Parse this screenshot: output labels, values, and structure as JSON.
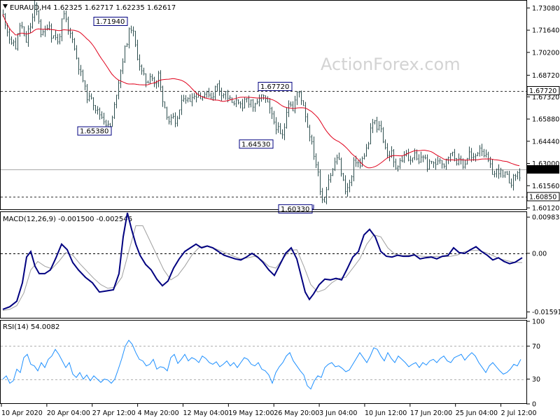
{
  "chart_data": [
    {
      "type": "candlestick",
      "header": "EURAUD,H4  1.62325 1.62717 1.62235 1.62617",
      "watermark": "ActionForex.com",
      "ylim": [
        1.6003,
        1.7355
      ],
      "y_ticks": [
        "1.73080",
        "1.71640",
        "1.70200",
        "1.68720",
        "1.67320",
        "1.65880",
        "1.64440",
        "1.63000",
        "1.61560",
        "1.60120"
      ],
      "horizontal_lines": [
        {
          "value": 1.6772,
          "label": "1.67720",
          "style": "dashed"
        },
        {
          "value": 1.6085,
          "label": "1.60850",
          "style": "dashed"
        },
        {
          "value": 1.62617,
          "label": "1.62617",
          "style": "solid-current-price"
        }
      ],
      "annotations": [
        {
          "label": "1.71940",
          "value": 1.7194
        },
        {
          "label": "1.65380",
          "value": 1.6538
        },
        {
          "label": "1.67720",
          "value": 1.6772
        },
        {
          "label": "1.64530",
          "value": 1.6453
        },
        {
          "label": "1.60330",
          "value": 1.6033
        }
      ],
      "moving_average": {
        "color": "#e0001b"
      },
      "price_path": {
        "x": [
          0,
          4,
          8,
          12,
          16,
          19,
          22,
          26,
          29,
          33,
          36,
          40,
          45,
          50,
          55,
          60,
          65,
          70,
          74,
          78,
          82,
          86,
          90,
          94,
          98,
          102,
          106,
          110,
          114,
          118,
          122,
          126,
          130,
          134,
          138,
          142,
          146,
          150,
          154,
          158,
          162,
          166,
          170,
          174,
          178,
          182,
          186,
          190,
          194,
          198,
          202,
          206,
          210,
          214,
          218,
          222,
          226,
          230,
          234,
          238,
          242,
          246,
          250,
          254,
          258,
          262,
          266,
          270,
          274,
          278,
          282,
          286,
          290,
          294,
          298,
          302,
          306,
          310,
          314,
          318,
          322,
          326,
          330,
          334,
          338,
          342,
          346,
          350,
          354,
          358,
          362,
          366,
          370,
          374,
          378,
          382,
          386,
          390,
          394,
          398,
          402,
          406,
          410,
          414,
          418,
          422,
          426,
          430,
          434,
          438,
          442,
          446,
          450,
          454,
          458,
          462,
          466,
          470,
          474,
          478,
          482,
          486,
          490,
          494,
          498,
          502,
          506,
          510,
          514,
          518,
          522,
          526,
          530,
          534,
          538,
          542,
          546,
          550,
          554,
          558,
          562,
          566,
          570,
          574,
          578,
          582,
          586,
          590,
          594,
          598,
          602,
          606,
          610,
          614,
          618,
          622,
          626,
          630,
          634,
          638,
          642,
          646,
          650,
          654,
          658,
          662,
          666,
          670,
          674,
          678,
          682,
          686,
          690,
          694,
          698,
          702,
          706,
          710,
          714,
          718,
          722,
          726,
          730,
          734,
          738
        ],
        "y": [
          1.726,
          1.72,
          1.713,
          1.706,
          1.71,
          1.703,
          1.718,
          1.721,
          1.712,
          1.709,
          1.716,
          1.72,
          1.731,
          1.726,
          1.712,
          1.716,
          1.722,
          1.711,
          1.714,
          1.708,
          1.716,
          1.727,
          1.722,
          1.713,
          1.715,
          1.704,
          1.697,
          1.689,
          1.684,
          1.676,
          1.671,
          1.674,
          1.668,
          1.664,
          1.662,
          1.66,
          1.657,
          1.654,
          1.6538,
          1.664,
          1.676,
          1.686,
          1.695,
          1.704,
          1.711,
          1.7194,
          1.714,
          1.703,
          1.696,
          1.689,
          1.685,
          1.682,
          1.688,
          1.685,
          1.679,
          1.688,
          1.676,
          1.668,
          1.662,
          1.656,
          1.66,
          1.654,
          1.662,
          1.667,
          1.674,
          1.672,
          1.67,
          1.675,
          1.673,
          1.676,
          1.672,
          1.677,
          1.674,
          1.676,
          1.672,
          1.678,
          1.681,
          1.677,
          1.675,
          1.676,
          1.672,
          1.67,
          1.667,
          1.674,
          1.668,
          1.664,
          1.673,
          1.67,
          1.671,
          1.666,
          1.667,
          1.673,
          1.673,
          1.672,
          1.668,
          1.663,
          1.658,
          1.654,
          1.651,
          1.6453,
          1.654,
          1.669,
          1.671,
          1.664,
          1.673,
          1.6772,
          1.672,
          1.667,
          1.656,
          1.649,
          1.64,
          1.632,
          1.623,
          1.611,
          1.6033,
          1.615,
          1.622,
          1.624,
          1.631,
          1.635,
          1.627,
          1.618,
          1.612,
          1.616,
          1.621,
          1.633,
          1.631,
          1.628,
          1.634,
          1.638,
          1.643,
          1.654,
          1.659,
          1.651,
          1.657,
          1.647,
          1.641,
          1.633,
          1.639,
          1.63,
          1.627,
          1.633,
          1.631,
          1.638,
          1.633,
          1.631,
          1.637,
          1.633,
          1.63,
          1.636,
          1.634,
          1.628,
          1.63,
          1.632,
          1.628,
          1.634,
          1.632,
          1.629,
          1.636,
          1.634,
          1.638,
          1.633,
          1.631,
          1.632,
          1.628,
          1.633,
          1.637,
          1.632,
          1.634,
          1.638,
          1.642,
          1.637,
          1.634,
          1.63,
          1.625,
          1.623,
          1.626,
          1.625,
          1.621,
          1.623,
          1.619,
          1.618,
          1.621,
          1.624,
          1.622,
          1.625,
          1.62617
        ]
      },
      "x_axis_labels": [
        "10 Apr 2020",
        "20 Apr 04:00",
        "27 Apr 12:00",
        "4 May 20:00",
        "12 May 04:00",
        "19 May 12:00",
        "26 May 20:00",
        "3 Jun 04:00",
        "10 Jun 12:00",
        "17 Jun 20:00",
        "25 Jun 04:00",
        "2 Jul 12:00"
      ]
    },
    {
      "type": "line",
      "header": "MACD(12,26,9) -0.001500 -0.002546",
      "ylim": [
        -0.0175,
        0.0112
      ],
      "y_ticks": [
        "0.009838",
        "0.00",
        "-0.015917"
      ],
      "zero_label": "0.00",
      "series": [
        {
          "role": "main",
          "color": "#000080",
          "x": [
            0,
            10,
            20,
            28,
            34,
            40,
            46,
            52,
            60,
            68,
            76,
            84,
            92,
            100,
            108,
            118,
            128,
            138,
            148,
            158,
            166,
            172,
            178,
            184,
            190,
            196,
            204,
            212,
            220,
            228,
            236,
            244,
            252,
            260,
            268,
            276,
            284,
            292,
            300,
            308,
            316,
            324,
            332,
            340,
            348,
            356,
            364,
            372,
            380,
            388,
            396,
            404,
            412,
            420,
            426,
            432,
            438,
            444,
            452,
            460,
            468,
            476,
            484,
            492,
            500,
            508,
            516,
            524,
            532,
            540,
            548,
            556,
            564,
            572,
            580,
            588,
            596,
            604,
            612,
            620,
            628,
            636,
            644,
            652,
            660,
            668,
            676,
            684,
            692,
            700,
            708,
            716,
            724,
            732,
            742
          ],
          "y": [
            -0.0152,
            -0.0145,
            -0.013,
            -0.008,
            -0.001,
            0.0005,
            -0.0035,
            -0.0055,
            -0.0055,
            -0.0045,
            -0.0012,
            0.0025,
            0.001,
            -0.0025,
            -0.0045,
            -0.0065,
            -0.008,
            -0.0105,
            -0.0102,
            -0.0099,
            -0.0055,
            0.0045,
            0.011,
            0.0065,
            0.0025,
            -0.0005,
            -0.003,
            -0.0045,
            -0.007,
            -0.0088,
            -0.0075,
            -0.004,
            -0.0015,
            0.0005,
            0.0015,
            0.0025,
            0.0015,
            0.002,
            0.0015,
            0.0005,
            -0.0005,
            -0.001,
            -0.0015,
            -0.0018,
            -0.001,
            0.0,
            -0.001,
            -0.0025,
            -0.0045,
            -0.006,
            -0.003,
            0.0,
            0.0015,
            -0.0015,
            -0.006,
            -0.0105,
            -0.0125,
            -0.011,
            -0.0085,
            -0.007,
            -0.0072,
            -0.0068,
            -0.0072,
            -0.0042,
            -0.001,
            0.0005,
            0.005,
            0.0065,
            0.0045,
            0.0005,
            -0.0008,
            -0.001,
            -0.0005,
            -0.0008,
            -0.0008,
            -0.0004,
            -0.0015,
            -0.0012,
            -0.001,
            -0.0015,
            -0.0008,
            -0.0006,
            0.0015,
            0.0002,
            0.0,
            0.001,
            0.0018,
            0.0005,
            -0.0005,
            -0.0018,
            -0.0012,
            -0.0022,
            -0.0028,
            -0.0024,
            -0.0012
          ]
        },
        {
          "role": "signal",
          "color": "#a0a0a0",
          "x": [
            0,
            10,
            20,
            30,
            40,
            50,
            60,
            70,
            80,
            90,
            100,
            110,
            120,
            130,
            140,
            150,
            160,
            170,
            180,
            190,
            200,
            210,
            220,
            230,
            240,
            250,
            260,
            270,
            280,
            290,
            300,
            310,
            320,
            330,
            340,
            350,
            360,
            370,
            380,
            390,
            400,
            410,
            420,
            430,
            440,
            450,
            460,
            470,
            480,
            490,
            500,
            510,
            520,
            530,
            540,
            550,
            560,
            570,
            580,
            590,
            600,
            610,
            620,
            630,
            640,
            650,
            660,
            670,
            680,
            690,
            700,
            710,
            720,
            730,
            742
          ],
          "y": [
            -0.0155,
            -0.0152,
            -0.0142,
            -0.0108,
            -0.0045,
            -0.0022,
            -0.0035,
            -0.0042,
            -0.0022,
            0.0002,
            -0.0005,
            -0.0028,
            -0.0048,
            -0.0068,
            -0.0085,
            -0.0095,
            -0.0092,
            -0.0065,
            0.0005,
            0.0075,
            0.0075,
            0.0035,
            -0.0005,
            -0.0045,
            -0.0072,
            -0.006,
            -0.0035,
            -0.0005,
            0.0015,
            0.002,
            0.0015,
            0.0008,
            0.0,
            -0.0008,
            -0.0015,
            -0.0012,
            -0.0008,
            -0.0018,
            -0.0035,
            -0.004,
            -0.0015,
            0.0008,
            0.001,
            -0.0035,
            -0.0085,
            -0.0105,
            -0.0098,
            -0.008,
            -0.0068,
            -0.0065,
            -0.004,
            -0.0015,
            0.0025,
            0.005,
            0.0045,
            0.0015,
            -0.0002,
            -0.0006,
            -0.0005,
            -0.0006,
            -0.0008,
            -0.0009,
            -0.0008,
            -0.0009,
            -0.0008,
            -0.0004,
            0.0005,
            0.0008,
            0.0008,
            0.0002,
            -0.0006,
            -0.0015,
            -0.002,
            -0.0024,
            -0.0025
          ]
        }
      ]
    },
    {
      "type": "line",
      "header": "RSI(14) 54.0082",
      "ylim": [
        0,
        100
      ],
      "y_ticks": [
        "100",
        "70",
        "30",
        "0"
      ],
      "levels": [
        70,
        30
      ],
      "series": [
        {
          "role": "rsi",
          "color": "#1e90ff",
          "x": [
            0,
            5,
            10,
            15,
            20,
            25,
            30,
            35,
            40,
            45,
            50,
            55,
            60,
            65,
            70,
            75,
            80,
            85,
            90,
            95,
            100,
            105,
            110,
            115,
            120,
            125,
            130,
            135,
            140,
            145,
            150,
            155,
            160,
            165,
            170,
            175,
            180,
            185,
            190,
            195,
            200,
            205,
            210,
            215,
            220,
            225,
            230,
            235,
            240,
            245,
            250,
            255,
            260,
            265,
            270,
            275,
            280,
            285,
            290,
            295,
            300,
            305,
            310,
            315,
            320,
            325,
            330,
            335,
            340,
            345,
            350,
            355,
            360,
            365,
            370,
            375,
            380,
            385,
            390,
            395,
            400,
            405,
            410,
            415,
            420,
            425,
            430,
            435,
            440,
            445,
            450,
            455,
            460,
            465,
            470,
            475,
            480,
            485,
            490,
            495,
            500,
            505,
            510,
            515,
            520,
            525,
            530,
            535,
            540,
            545,
            550,
            555,
            560,
            565,
            570,
            575,
            580,
            585,
            590,
            595,
            600,
            605,
            610,
            615,
            620,
            625,
            630,
            635,
            640,
            645,
            650,
            655,
            660,
            665,
            670,
            675,
            680,
            685,
            690,
            695,
            700,
            705,
            710,
            715,
            720,
            725,
            730,
            735,
            740
          ],
          "y": [
            30,
            34,
            25,
            28,
            42,
            38,
            56,
            60,
            48,
            46,
            40,
            50,
            44,
            54,
            58,
            66,
            60,
            52,
            44,
            50,
            36,
            32,
            38,
            30,
            35,
            28,
            34,
            30,
            26,
            30,
            29,
            25,
            30,
            42,
            55,
            70,
            77,
            72,
            62,
            54,
            52,
            46,
            48,
            54,
            42,
            45,
            44,
            40,
            56,
            60,
            49,
            54,
            60,
            52,
            56,
            54,
            50,
            58,
            55,
            50,
            48,
            51,
            45,
            48,
            52,
            46,
            50,
            44,
            50,
            56,
            54,
            48,
            46,
            50,
            42,
            40,
            35,
            25,
            38,
            45,
            50,
            58,
            62,
            52,
            46,
            40,
            35,
            22,
            18,
            28,
            34,
            32,
            44,
            48,
            50,
            45,
            46,
            43,
            39,
            41,
            48,
            55,
            62,
            56,
            50,
            58,
            68,
            66,
            58,
            52,
            62,
            55,
            50,
            58,
            54,
            50,
            45,
            48,
            50,
            44,
            50,
            47,
            52,
            54,
            50,
            55,
            58,
            52,
            50,
            56,
            58,
            60,
            53,
            58,
            62,
            58,
            50,
            44,
            38,
            46,
            50,
            45,
            40,
            36,
            38,
            42,
            48,
            46,
            54
          ]
        }
      ]
    }
  ]
}
